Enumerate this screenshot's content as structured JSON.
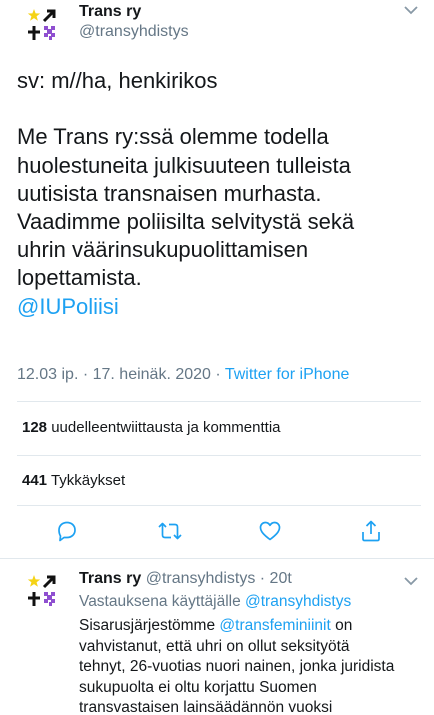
{
  "tweet": {
    "author_name": "Trans ry",
    "author_handle": "@transyhdistys",
    "lines": [
      "sv: m//ha, henkirikos",
      "Me Trans ry:ssä olemme todella",
      "huolestuneita julkisuuteen tulleista",
      "uutisista transnaisen murhasta.",
      "Vaadimme poliisilta selvitystä sekä",
      "uhrin väärinsukupuolittamisen",
      "lopettamista."
    ],
    "mention": "@IUPoliisi",
    "timestamp": "12.03 ip. · 17. heinäk. 2020 · ",
    "source": "Twitter for iPhone"
  },
  "stats": {
    "retweets_count": "128",
    "retweets_label": "uudelleentwiittausta ja kommenttia",
    "likes_count": "441",
    "likes_label": "Tykkäykset"
  },
  "actions": {
    "icons": [
      "reply-icon",
      "retweet-icon",
      "like-icon",
      "share-icon"
    ]
  },
  "reply": {
    "author_name": "Trans ry",
    "author_handle": "@transyhdistys · 20t",
    "reply_prefix": "Vastauksena käyttäjälle ",
    "reply_mention": "@transyhdistys",
    "line1_pre": "Sisarusjärjestömme ",
    "line1_mention": "@transfeminiinit",
    "line1_post": " on",
    "lines": [
      "vahvistanut, että uhri on ollut seksityötä",
      "tehnyt, 26-vuotias nuori nainen, jonka juridista",
      "sukupuolta ei oltu korjattu Suomen",
      "transvastaisen lainsäädännön vuoksi"
    ]
  },
  "colors": {
    "accent": "#1da1f2",
    "secondary_text": "#657786",
    "divider": "#e1e8ed",
    "logo_yellow": "#f5d316",
    "logo_purple": "#8f4fd0"
  }
}
